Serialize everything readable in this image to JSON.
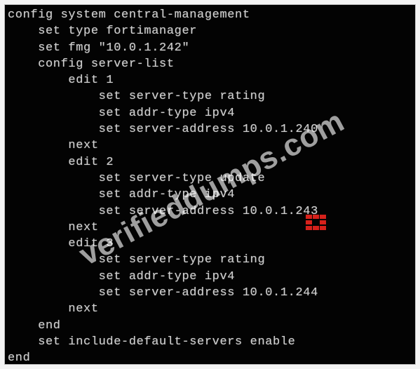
{
  "terminal": {
    "lines": [
      "config system central-management",
      "    set type fortimanager",
      "    set fmg \"10.0.1.242\"",
      "    config server-list",
      "        edit 1",
      "            set server-type rating",
      "            set addr-type ipv4",
      "            set server-address 10.0.1.240",
      "        next",
      "        edit 2",
      "            set server-type update",
      "            set addr-type ipv4",
      "            set server-address 10.0.1.243",
      "        next",
      "        edit 3",
      "            set server-type rating",
      "            set addr-type ipv4",
      "            set server-address 10.0.1.244",
      "        next",
      "    end",
      "    set include-default-servers enable",
      "end"
    ]
  },
  "watermark": {
    "text": "verifieddumps.com",
    "logo": "fortinet-logo-icon",
    "logo_color": "#d6211b"
  },
  "colors": {
    "background": "#030303",
    "text": "#cfcfcf"
  }
}
